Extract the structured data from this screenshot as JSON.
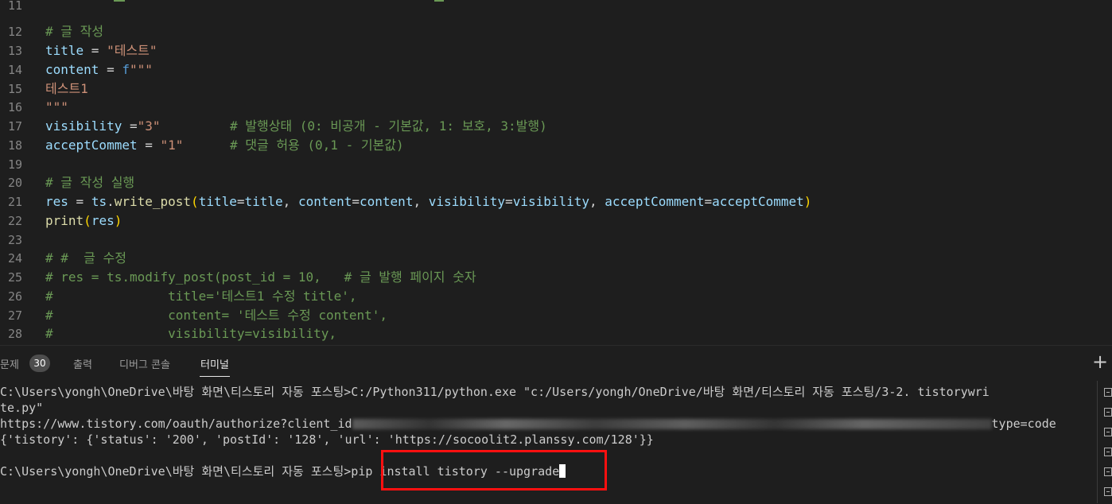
{
  "editor": {
    "line_numbers": [
      "11",
      "12",
      "13",
      "14",
      "15",
      "16",
      "17",
      "18",
      "19",
      "20",
      "21",
      "22",
      "23",
      "24",
      "25",
      "26",
      "27",
      "28"
    ],
    "lines": {
      "l12": "# 글 작성",
      "l13_var": "title",
      "l13_op": " = ",
      "l13_str": "\"테스트\"",
      "l14_var": "content",
      "l14_op": " = ",
      "l14_f": "f",
      "l14_str": "\"\"\"",
      "l15": "테스트1",
      "l16": "\"\"\"",
      "l17_var": "visibility",
      "l17_op": " =",
      "l17_str": "\"3\"",
      "l17_cm": "# 발행상태 (0: 비공개 - 기본값, 1: 보호, 3:발행)",
      "l18_var": "acceptCommet",
      "l18_op": " = ",
      "l18_str": "\"1\"",
      "l18_cm": "# 댓글 허용 (0,1 - 기본값)",
      "l20": "# 글 작성 실행",
      "l21_res": "res",
      "l21_eq": " = ",
      "l21_ts": "ts",
      "l21_dot": ".",
      "l21_fn": "write_post",
      "l21_po": "(",
      "l21_a1": "title",
      "l21_e1": "=",
      "l21_v1": "title",
      "l21_c1": ", ",
      "l21_a2": "content",
      "l21_e2": "=",
      "l21_v2": "content",
      "l21_c2": ", ",
      "l21_a3": "visibility",
      "l21_e3": "=",
      "l21_v3": "visibility",
      "l21_c3": ", ",
      "l21_a4": "acceptComment",
      "l21_e4": "=",
      "l21_v4": "acceptCommet",
      "l21_pc": ")",
      "l22_fn": "print",
      "l22_po": "(",
      "l22_arg": "res",
      "l22_pc": ")",
      "l24": "# #  글 수정",
      "l25": "# res = ts.modify_post(post_id = 10,   # 글 발행 페이지 숫자",
      "l26": "#               title='테스트1 수정 title',",
      "l27": "#               content= '테스트 수정 content',",
      "l28": "#               visibility=visibility,"
    }
  },
  "panel": {
    "tabs": {
      "problems": "문제",
      "problems_count": "30",
      "output": "출력",
      "debug_console": "디버그 콘솔",
      "terminal": "터미널"
    },
    "terminal_lines": {
      "cmd1_line1": "C:\\Users\\yongh\\OneDrive\\바탕 화면\\티스토리 자동 포스팅>C:/Python311/python.exe \"c:/Users/yongh/OneDrive/바탕 화면/티스토리 자동 포스팅/3-2. tistorywri",
      "cmd1_line2": "te.py\"",
      "auth_prefix": "https://www.tistory.com/oauth/authorize?client_id",
      "auth_suffix": "type=code",
      "result_prefix": "{'tistory': {'status': '200', 'postId': '128', 'url': '",
      "result_suffix": "https://socoolit2.planssy.com/128'}}",
      "prompt": "C:\\Users\\yongh\\OneDrive\\바탕 화면\\티스토리 자동 포스팅",
      "command": ">pip install tistory --upgrade"
    }
  },
  "colors": {
    "highlight_box": "#ff1010",
    "background": "#1e1e1e"
  }
}
